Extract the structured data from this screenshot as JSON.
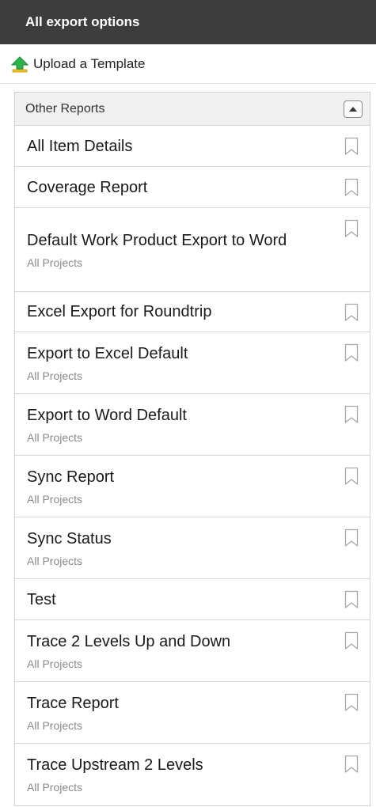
{
  "header": {
    "title": "All export options"
  },
  "upload": {
    "label": "Upload a Template",
    "icon": "upload-arrow-icon"
  },
  "reports": {
    "section_title": "Other Reports",
    "items": [
      {
        "title": "All Item Details",
        "sub": ""
      },
      {
        "title": "Coverage Report",
        "sub": ""
      },
      {
        "title": "Default Work Product Export to Word",
        "sub": "All Projects"
      },
      {
        "title": "Excel Export for Roundtrip",
        "sub": ""
      },
      {
        "title": "Export to Excel Default",
        "sub": "All Projects"
      },
      {
        "title": "Export to Word Default",
        "sub": "All Projects"
      },
      {
        "title": "Sync Report",
        "sub": "All Projects"
      },
      {
        "title": "Sync Status",
        "sub": "All Projects"
      },
      {
        "title": "Test",
        "sub": ""
      },
      {
        "title": "Trace 2 Levels Up and Down",
        "sub": "All Projects"
      },
      {
        "title": "Trace Report",
        "sub": "All Projects"
      },
      {
        "title": "Trace Upstream 2 Levels",
        "sub": "All Projects"
      }
    ]
  },
  "colors": {
    "header_bg": "#3d3d3d",
    "upload_icon": "#2db34a",
    "subtext": "#8a8a8a"
  }
}
